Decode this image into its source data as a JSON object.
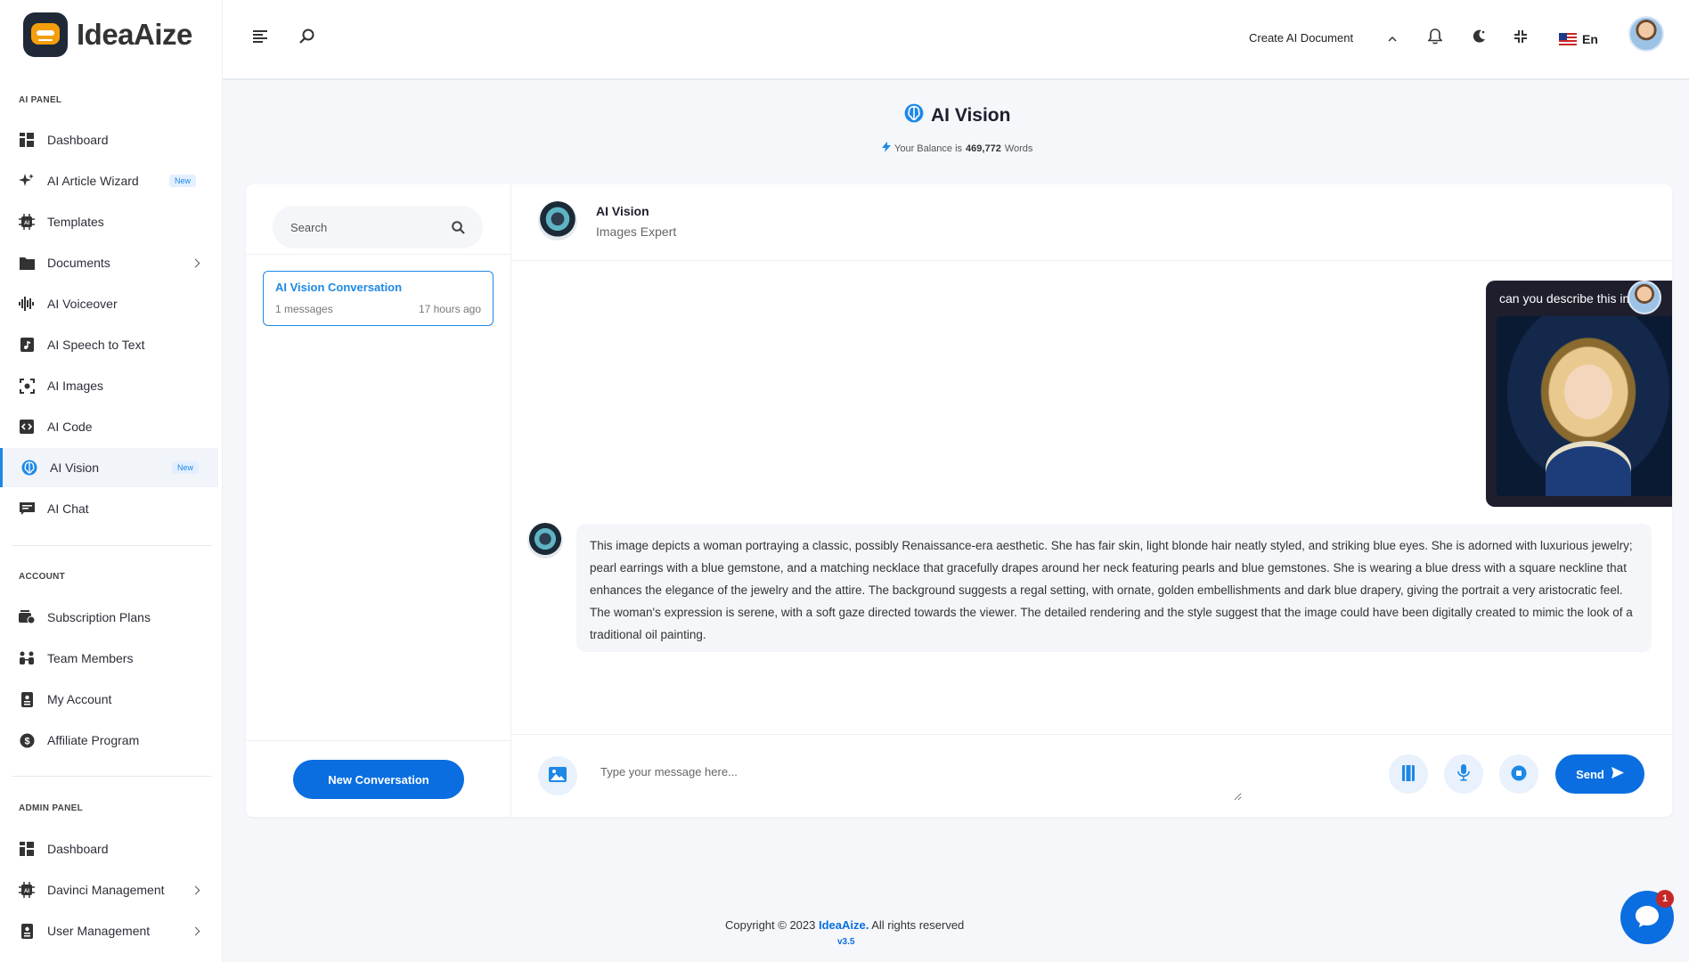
{
  "brand": {
    "name": "IdeaAize"
  },
  "sidebar": {
    "sections": [
      "AI PANEL",
      "ACCOUNT",
      "ADMIN PANEL"
    ],
    "ai_panel": [
      {
        "label": "Dashboard",
        "icon": "dashboard-icon"
      },
      {
        "label": "AI Article Wizard",
        "icon": "sparkles-icon",
        "badge": "New"
      },
      {
        "label": "Templates",
        "icon": "ai-chip-icon"
      },
      {
        "label": "Documents",
        "icon": "folder-icon",
        "has_submenu": true
      },
      {
        "label": "AI Voiceover",
        "icon": "waveform-icon"
      },
      {
        "label": "AI Speech to Text",
        "icon": "music-file-icon"
      },
      {
        "label": "AI Images",
        "icon": "image-scan-icon"
      },
      {
        "label": "AI Code",
        "icon": "code-icon"
      },
      {
        "label": "AI Vision",
        "icon": "brain-icon",
        "badge": "New",
        "active": true
      },
      {
        "label": "AI Chat",
        "icon": "chat-icon"
      }
    ],
    "account": [
      {
        "label": "Subscription Plans",
        "icon": "money-icon"
      },
      {
        "label": "Team Members",
        "icon": "team-icon"
      },
      {
        "label": "My Account",
        "icon": "id-card-icon"
      },
      {
        "label": "Affiliate Program",
        "icon": "dollar-coin-icon"
      }
    ],
    "admin": [
      {
        "label": "Dashboard",
        "icon": "dashboard-icon"
      },
      {
        "label": "Davinci Management",
        "icon": "ai-chip-icon",
        "has_submenu": true
      },
      {
        "label": "User Management",
        "icon": "id-card-icon",
        "has_submenu": true
      }
    ]
  },
  "header": {
    "create_doc": "Create AI Document",
    "lang": "En"
  },
  "page": {
    "title": "AI Vision",
    "balance_prefix": "Your Balance is",
    "balance_value": "469,772",
    "balance_suffix": "Words"
  },
  "conversations": {
    "search_placeholder": "Search",
    "items": [
      {
        "title": "AI Vision Conversation",
        "count": "1 messages",
        "time": "17 hours ago"
      }
    ],
    "new_button": "New Conversation"
  },
  "chat": {
    "name": "AI Vision",
    "role": "Images Expert",
    "user_message": "can you describe this image?",
    "bot_message": "This image depicts a woman portraying a classic, possibly Renaissance-era aesthetic. She has fair skin, light blonde hair neatly styled, and striking blue eyes. She is adorned with luxurious jewelry; pearl earrings with a blue gemstone, and a matching necklace that gracefully drapes around her neck featuring pearls and blue gemstones. She is wearing a blue dress with a square neckline that enhances the elegance of the jewelry and the attire. The background suggests a regal setting, with ornate, golden embellishments and dark blue drapery, giving the portrait a very aristocratic feel. The woman's expression is serene, with a soft gaze directed towards the viewer. The detailed rendering and the style suggest that the image could have been digitally created to mimic the look of a traditional oil painting.",
    "input_placeholder": "Type your message here...",
    "send_label": "Send"
  },
  "footer": {
    "copyright_prefix": "Copyright © 2023",
    "brand": "IdeaAize.",
    "copyright_suffix": "All rights reserved",
    "version": "v3.5"
  },
  "widget": {
    "badge": "1"
  },
  "colors": {
    "accent": "#0a6ee0",
    "dark": "#1e1e2d",
    "badge": "#c62828"
  }
}
